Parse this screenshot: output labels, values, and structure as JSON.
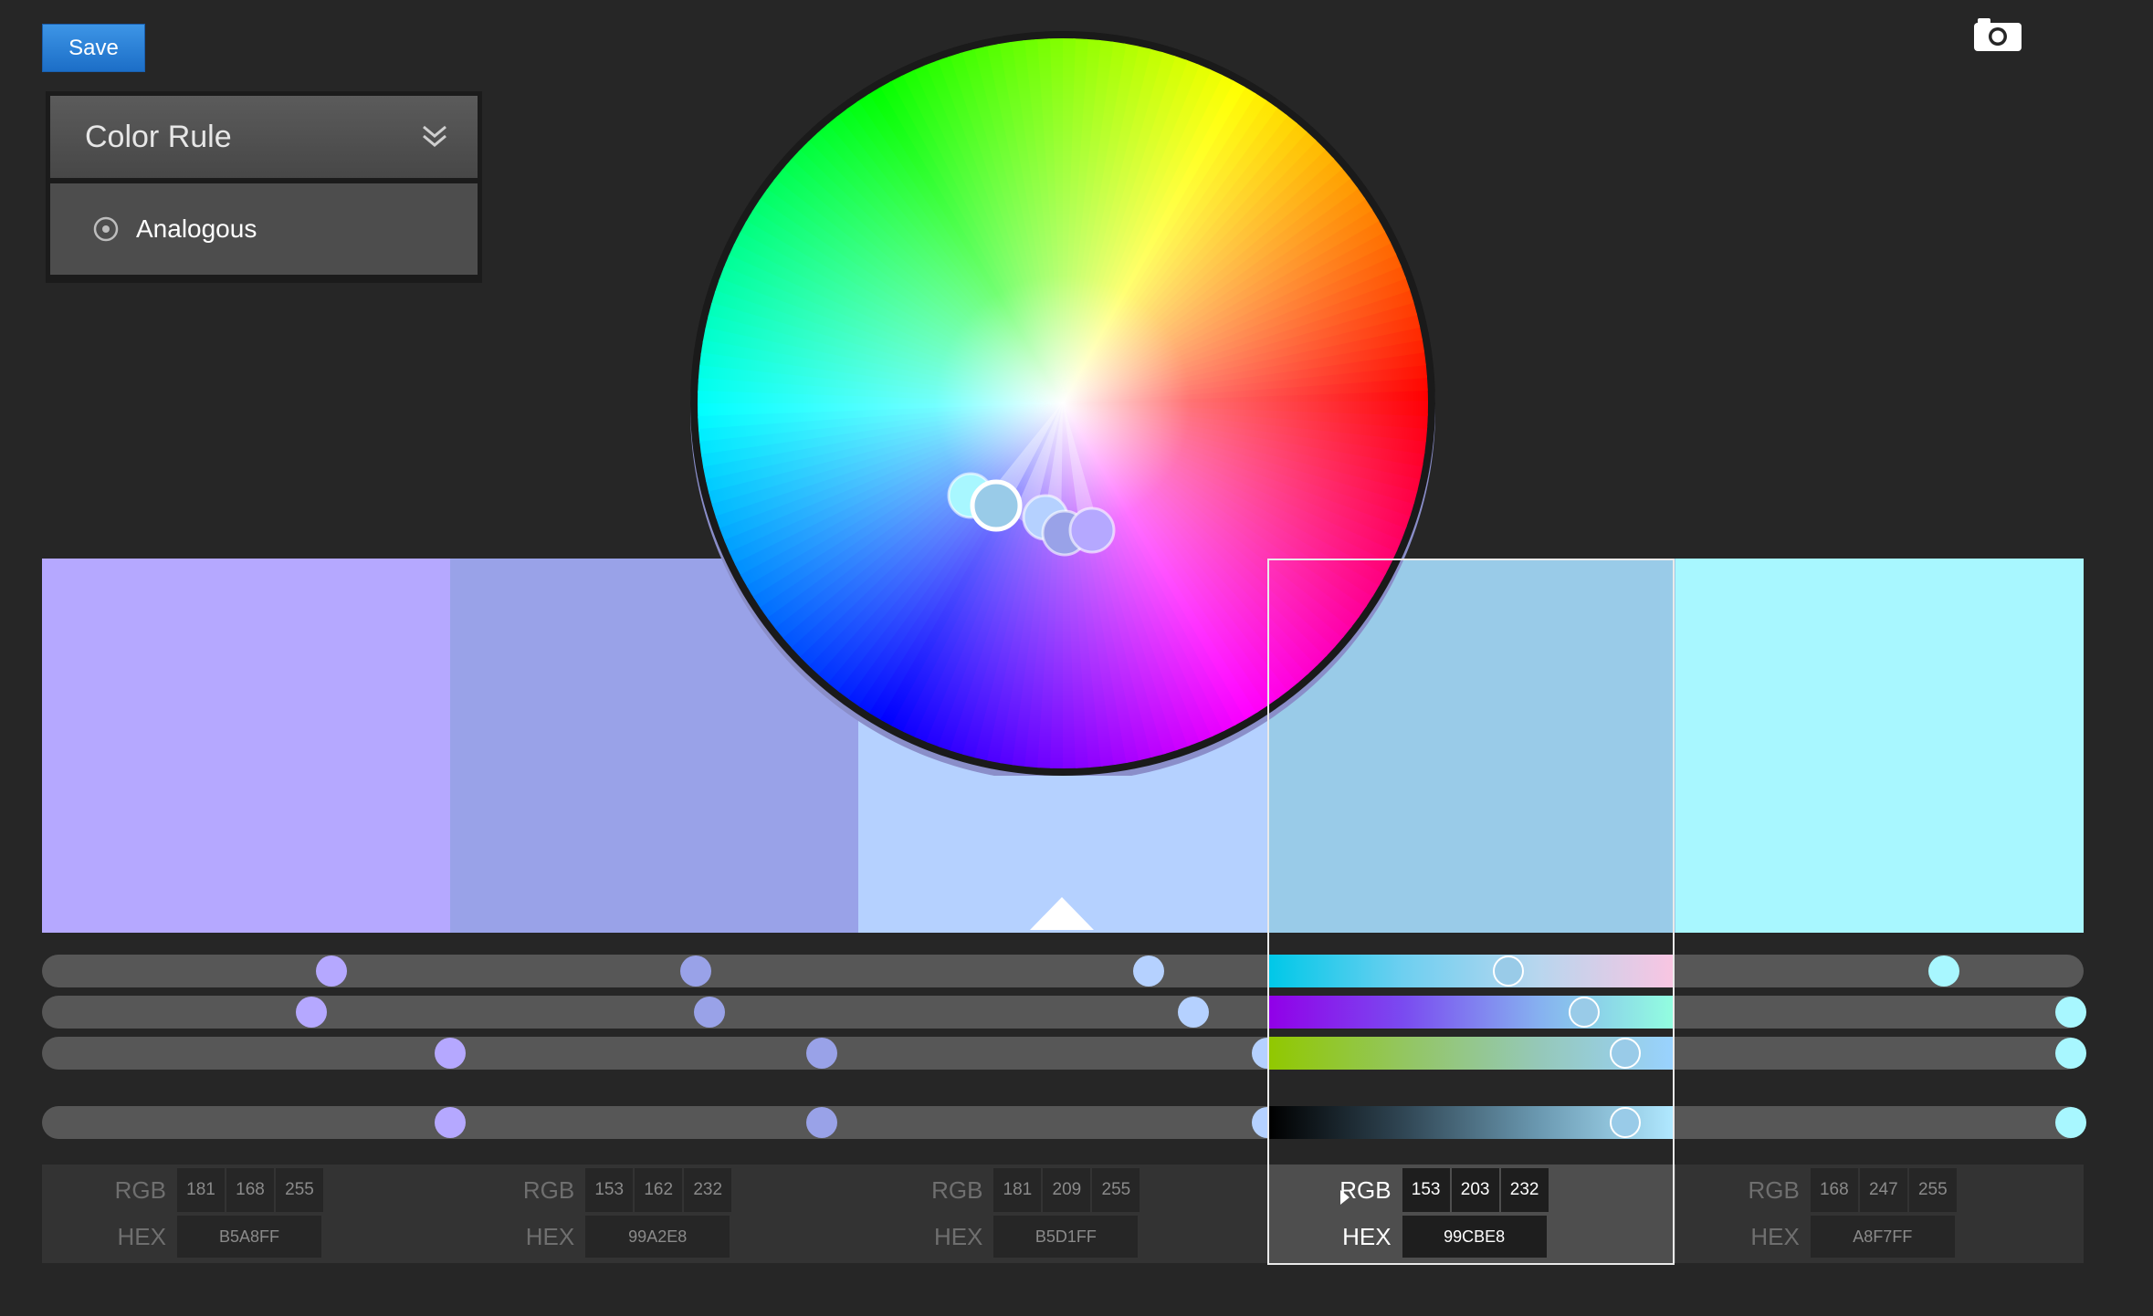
{
  "toolbar": {
    "save_label": "Save"
  },
  "icons": {
    "camera": "camera-icon",
    "chevron": "double-chevron-down-icon",
    "radio": "radio-icon"
  },
  "color_rule": {
    "title": "Color Rule",
    "selected": "Analogous"
  },
  "swatches": [
    {
      "hex": "#B5A8FF",
      "rgb": [
        "181",
        "168",
        "255"
      ],
      "hex_label": "B5A8FF"
    },
    {
      "hex": "#99A2E8",
      "rgb": [
        "153",
        "162",
        "232"
      ],
      "hex_label": "99A2E8"
    },
    {
      "hex": "#B5D1FF",
      "rgb": [
        "181",
        "209",
        "255"
      ],
      "hex_label": "B5D1FF"
    },
    {
      "hex": "#99CBE8",
      "rgb": [
        "153",
        "203",
        "232"
      ],
      "hex_label": "99CBE8"
    },
    {
      "hex": "#A8F7FF",
      "rgb": [
        "168",
        "247",
        "255"
      ],
      "hex_label": "A8F7FF"
    }
  ],
  "selected_index": 3,
  "labels": {
    "rgb": "RGB",
    "hex": "HEX"
  }
}
